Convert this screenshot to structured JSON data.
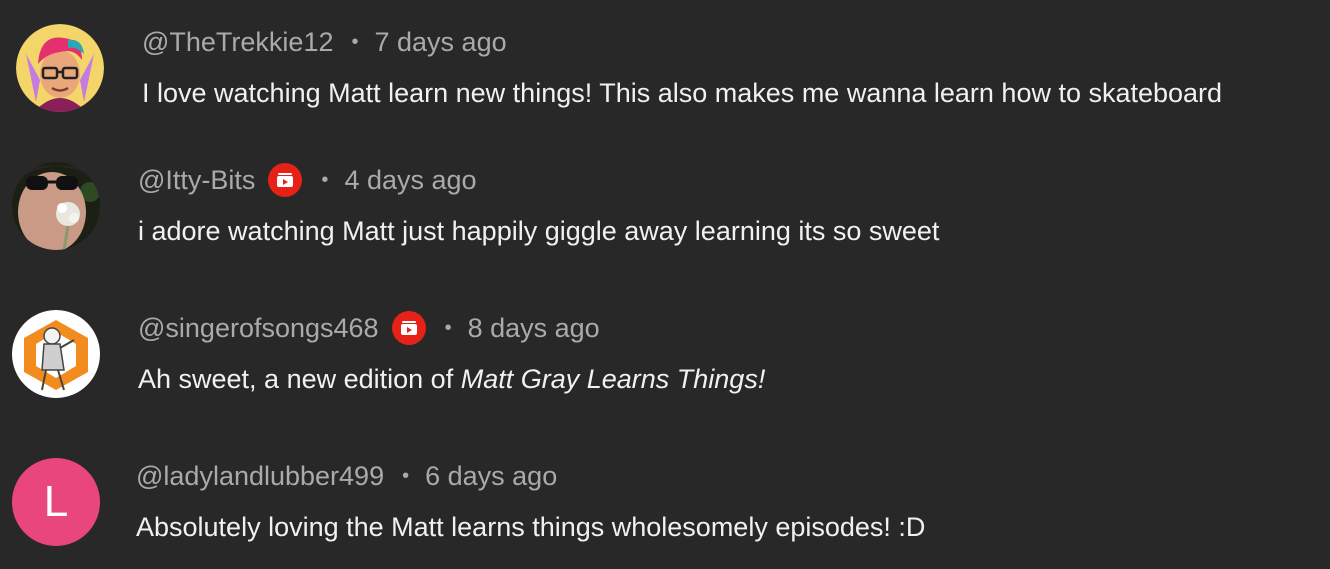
{
  "comments": [
    {
      "author": "@TheTrekkie12",
      "time": "7 days ago",
      "text": "I love watching Matt learn new things! This also makes me wanna learn how to skateboard",
      "badge": false,
      "avatar_icon": "cartoon-person-pink-hair-glasses-icon"
    },
    {
      "author": "@Itty-Bits",
      "time": "4 days ago",
      "text": "i adore watching Matt just happily giggle away learning its so sweet",
      "badge": true,
      "avatar_icon": "photo-person-blowing-dandelion-icon"
    },
    {
      "author": "@singerofsongs468",
      "time": "8 days ago",
      "text_prefix": "Ah sweet, a new edition of ",
      "text_italic": "Matt Gray Learns Things!",
      "badge": true,
      "avatar_icon": "sketch-character-orange-hexagon-icon"
    },
    {
      "author": "@ladylandlubber499",
      "time": "6 days ago",
      "text": "Absolutely loving the Matt learns things wholesomely episodes! :D",
      "badge": false,
      "avatar_letter": "L",
      "avatar_color": "#e8467c"
    }
  ],
  "separator": "•",
  "colors": {
    "background": "#282828",
    "meta_text": "#aaaaaa",
    "body_text": "#f1f1f1",
    "badge_red": "#e62117"
  }
}
